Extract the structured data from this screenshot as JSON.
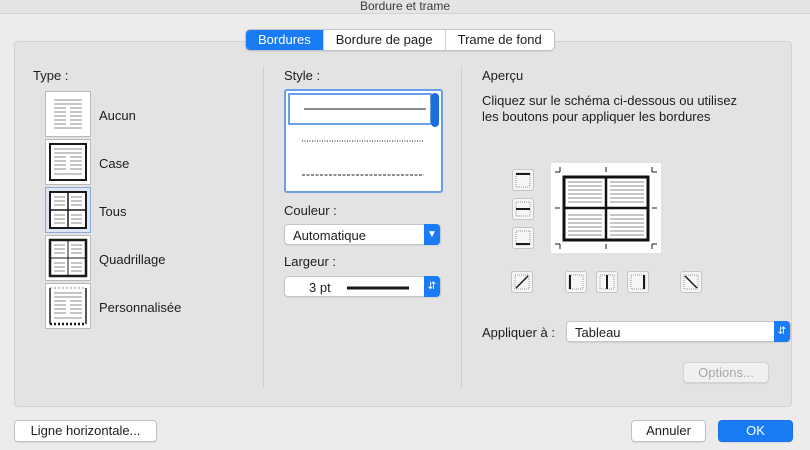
{
  "window": {
    "title": "Bordure et trame"
  },
  "tabs": [
    {
      "label": "Bordures",
      "active": true
    },
    {
      "label": "Bordure de page",
      "active": false
    },
    {
      "label": "Trame de fond",
      "active": false
    }
  ],
  "type_section": {
    "label": "Type :",
    "items": [
      {
        "label": "Aucun",
        "selected": false
      },
      {
        "label": "Case",
        "selected": false
      },
      {
        "label": "Tous",
        "selected": true
      },
      {
        "label": "Quadrillage",
        "selected": false
      },
      {
        "label": "Personnalisée",
        "selected": false
      }
    ]
  },
  "style_section": {
    "style_label": "Style :",
    "line_styles": [
      "solid",
      "dotted",
      "dashed"
    ],
    "selected_style": "solid",
    "color_label": "Couleur :",
    "color_value": "Automatique",
    "width_label": "Largeur :",
    "width_value": "3 pt"
  },
  "preview_section": {
    "title": "Aperçu",
    "instructions_line1": "Cliquez sur le schéma ci-dessous ou utilisez",
    "instructions_line2": "les boutons pour appliquer les bordures",
    "apply_label": "Appliquer à :",
    "apply_value": "Tableau",
    "options_label": "Options..."
  },
  "footer": {
    "horizontal_line_label": "Ligne horizontale...",
    "cancel_label": "Annuler",
    "ok_label": "OK"
  },
  "colors": {
    "accent": "#1a7cf5",
    "selection_bg": "#dce6f5",
    "panel_bg": "#e3e3e3"
  }
}
